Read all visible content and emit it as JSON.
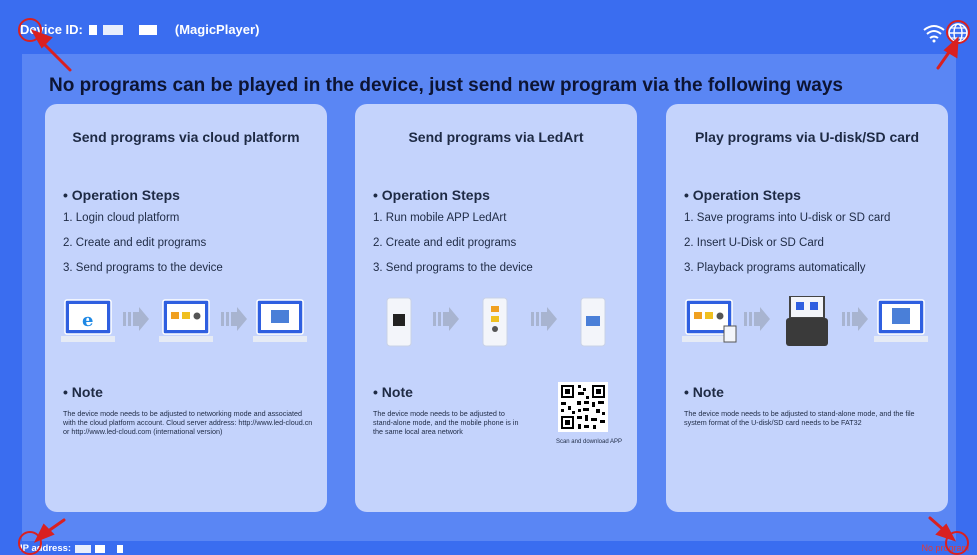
{
  "header": {
    "device_id_label": "Device ID:",
    "player_name": "(MagicPlayer)"
  },
  "headline": "No programs can be played in the device, just send new program via the following ways",
  "cards": [
    {
      "title": "Send programs via cloud platform",
      "steps_heading": "• Operation Steps",
      "steps": [
        "1. Login cloud platform",
        "2. Create and edit programs",
        "3. Send programs to the device"
      ],
      "note_heading": "• Note",
      "note": "The device mode needs to be adjusted to networking mode and associated with the cloud platform account. Cloud server address: http://www.led-cloud.cn or http://www.led-cloud.com (international version)"
    },
    {
      "title": "Send programs via LedArt",
      "steps_heading": "• Operation Steps",
      "steps": [
        "1. Run mobile APP LedArt",
        "2. Create and edit programs",
        "3. Send programs to the device"
      ],
      "note_heading": "• Note",
      "note": "The device mode needs to be adjusted to stand-alone mode, and the mobile phone is in the same local area network",
      "qr_caption": "Scan and download APP"
    },
    {
      "title": "Play programs via U-disk/SD card",
      "steps_heading": "• Operation Steps",
      "steps": [
        "1. Save programs into U-disk or SD card",
        "2. Insert U-Disk or SD Card",
        "3. Playback programs automatically"
      ],
      "note_heading": "• Note",
      "note": "The device mode needs to be adjusted to stand-alone mode, and the file system format of the U-disk/SD card needs to be FAT32"
    }
  ],
  "footer": {
    "ip_label": "IP address:",
    "status": "No program"
  },
  "icons": {
    "wifi": "wifi-icon",
    "globe": "globe-icon",
    "annotation_color": "#d92020"
  },
  "colors": {
    "background": "#3a6df0",
    "panel": "#5a86f4",
    "card": "#c4d3fc",
    "status_text": "#e53935"
  }
}
